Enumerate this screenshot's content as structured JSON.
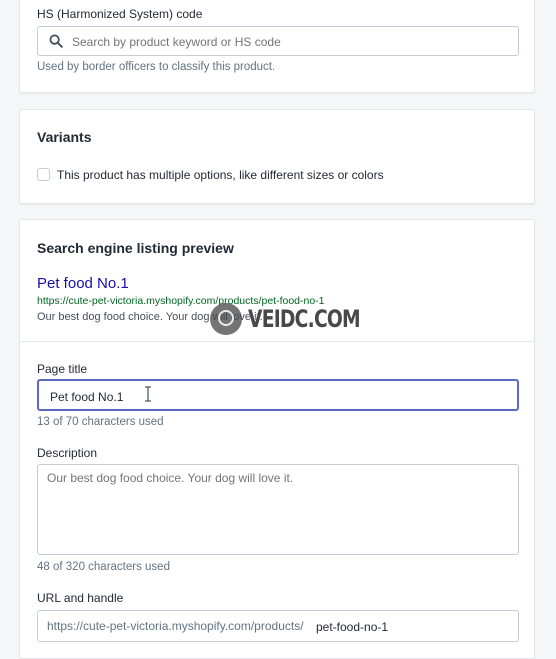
{
  "hs_card": {
    "label": "HS (Harmonized System) code",
    "search_placeholder": "Search by product keyword or HS code",
    "help": "Used by border officers to classify this product.",
    "search_icon": "search-icon"
  },
  "variants_card": {
    "title": "Variants",
    "checkbox_label": "This product has multiple options, like different sizes or colors",
    "checked": false
  },
  "seo_card": {
    "title": "Search engine listing preview",
    "preview": {
      "title": "Pet food No.1",
      "url": "https://cute-pet-victoria.myshopify.com/products/pet-food-no-1",
      "description": "Our best dog food choice. Your dog will love it."
    },
    "page_title": {
      "label": "Page title",
      "value": "Pet food No.1",
      "help": "13 of 70 characters used"
    },
    "description": {
      "label": "Description",
      "placeholder": "Our best dog food choice. Your dog will love it.",
      "help": "48 of 320 characters used"
    },
    "url_handle": {
      "label": "URL and handle",
      "prefix": "https://cute-pet-victoria.myshopify.com/products/",
      "value": "pet-food-no-1"
    }
  },
  "watermark": {
    "text": "VEIDC.COM",
    "logo": "watermark-logo-icon"
  },
  "colors": {
    "accent": "#5c6ac4",
    "link_title": "#1a0dab",
    "url_green": "#006621",
    "text_muted": "#637381",
    "background": "#f4f6f8"
  }
}
